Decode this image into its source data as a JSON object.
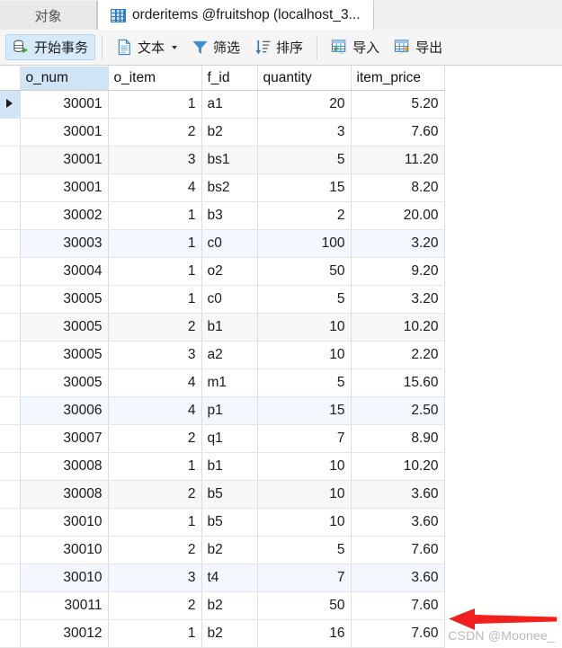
{
  "tabs": [
    {
      "label": "对象",
      "icon": null,
      "active": false
    },
    {
      "label": "orderitems @fruitshop (localhost_3...",
      "icon": "table-grid-icon",
      "active": true
    }
  ],
  "toolbar": {
    "buttons": [
      {
        "label": "开始事务",
        "icon": "transaction-icon",
        "active": true,
        "caret": false
      },
      {
        "label": "文本",
        "icon": "text-document-icon",
        "active": false,
        "caret": true
      },
      {
        "label": "筛选",
        "icon": "filter-funnel-icon",
        "active": false,
        "caret": false
      },
      {
        "label": "排序",
        "icon": "sort-descending-icon",
        "active": false,
        "caret": false
      },
      {
        "label": "导入",
        "icon": "import-grid-icon",
        "active": false,
        "caret": false
      },
      {
        "label": "导出",
        "icon": "export-grid-icon",
        "active": false,
        "caret": false
      }
    ]
  },
  "grid": {
    "columns": [
      "o_num",
      "o_item",
      "f_id",
      "quantity",
      "item_price"
    ],
    "selected_column": "o_num",
    "current_row_index": 0,
    "rows": [
      {
        "o_num": "30001",
        "o_item": "1",
        "f_id": "a1",
        "quantity": "20",
        "item_price": "5.20"
      },
      {
        "o_num": "30001",
        "o_item": "2",
        "f_id": "b2",
        "quantity": "3",
        "item_price": "7.60"
      },
      {
        "o_num": "30001",
        "o_item": "3",
        "f_id": "bs1",
        "quantity": "5",
        "item_price": "11.20"
      },
      {
        "o_num": "30001",
        "o_item": "4",
        "f_id": "bs2",
        "quantity": "15",
        "item_price": "8.20"
      },
      {
        "o_num": "30002",
        "o_item": "1",
        "f_id": "b3",
        "quantity": "2",
        "item_price": "20.00"
      },
      {
        "o_num": "30003",
        "o_item": "1",
        "f_id": "c0",
        "quantity": "100",
        "item_price": "3.20"
      },
      {
        "o_num": "30004",
        "o_item": "1",
        "f_id": "o2",
        "quantity": "50",
        "item_price": "9.20"
      },
      {
        "o_num": "30005",
        "o_item": "1",
        "f_id": "c0",
        "quantity": "5",
        "item_price": "3.20"
      },
      {
        "o_num": "30005",
        "o_item": "2",
        "f_id": "b1",
        "quantity": "10",
        "item_price": "10.20"
      },
      {
        "o_num": "30005",
        "o_item": "3",
        "f_id": "a2",
        "quantity": "10",
        "item_price": "2.20"
      },
      {
        "o_num": "30005",
        "o_item": "4",
        "f_id": "m1",
        "quantity": "5",
        "item_price": "15.60"
      },
      {
        "o_num": "30006",
        "o_item": "4",
        "f_id": "p1",
        "quantity": "15",
        "item_price": "2.50"
      },
      {
        "o_num": "30007",
        "o_item": "2",
        "f_id": "q1",
        "quantity": "7",
        "item_price": "8.90"
      },
      {
        "o_num": "30008",
        "o_item": "1",
        "f_id": "b1",
        "quantity": "10",
        "item_price": "10.20"
      },
      {
        "o_num": "30008",
        "o_item": "2",
        "f_id": "b5",
        "quantity": "10",
        "item_price": "3.60"
      },
      {
        "o_num": "30010",
        "o_item": "1",
        "f_id": "b5",
        "quantity": "10",
        "item_price": "3.60"
      },
      {
        "o_num": "30010",
        "o_item": "2",
        "f_id": "b2",
        "quantity": "5",
        "item_price": "7.60"
      },
      {
        "o_num": "30010",
        "o_item": "3",
        "f_id": "t4",
        "quantity": "7",
        "item_price": "3.60"
      },
      {
        "o_num": "30011",
        "o_item": "2",
        "f_id": "b2",
        "quantity": "50",
        "item_price": "7.60"
      },
      {
        "o_num": "30012",
        "o_item": "1",
        "f_id": "b2",
        "quantity": "16",
        "item_price": "7.60"
      }
    ],
    "row_tints": [
      "none",
      "none",
      "gray",
      "none",
      "none",
      "blue",
      "none",
      "none",
      "gray",
      "none",
      "none",
      "blue",
      "none",
      "none",
      "gray",
      "none",
      "none",
      "blue",
      "none",
      "none"
    ]
  },
  "annotation": {
    "arrow": {
      "name": "red-left-arrow",
      "color": "#f21f1f"
    },
    "watermark": "CSDN @Moonee_"
  },
  "colors": {
    "accent": "#2f7fc4",
    "selection": "#cfe4f5",
    "toolbar_bg": "#f5f5f5",
    "tint_gray": "#f7f7f7",
    "tint_blue": "#f2f8fd",
    "arrow_red": "#f21f1f"
  }
}
